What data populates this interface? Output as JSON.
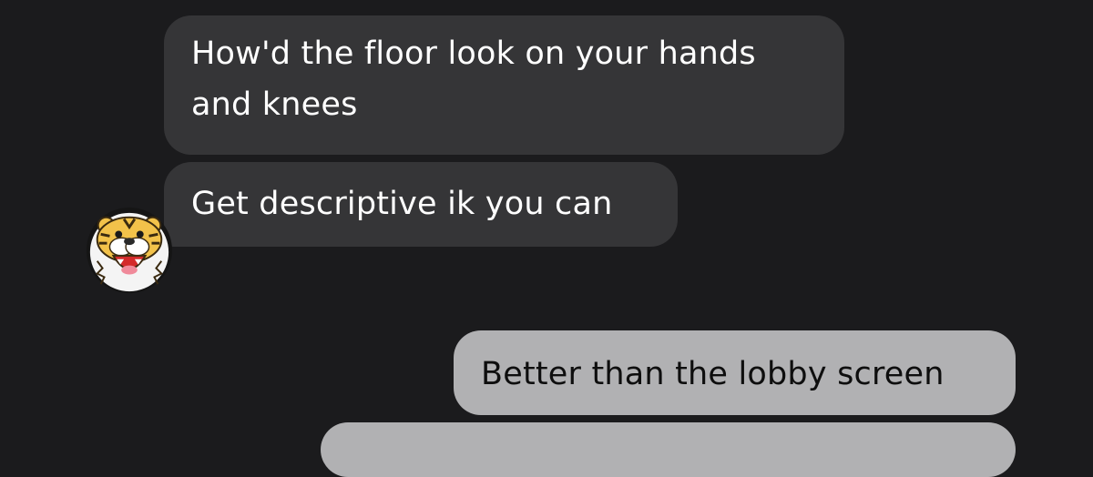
{
  "conversation": {
    "messages": [
      {
        "direction": "incoming",
        "lines": [
          "How'd the floor look on your hands",
          "and knees"
        ]
      },
      {
        "direction": "incoming",
        "text": "Get descriptive ik you can"
      },
      {
        "direction": "outgoing",
        "text": "Better than the lobby screen"
      }
    ],
    "contact": {
      "avatar_icon": "tiger-face-icon"
    }
  },
  "colors": {
    "background": "#1b1b1d",
    "incoming_bubble": "#353537",
    "incoming_text": "#ffffff",
    "outgoing_bubble": "#b1b1b3",
    "outgoing_text": "#0e0e0e"
  }
}
